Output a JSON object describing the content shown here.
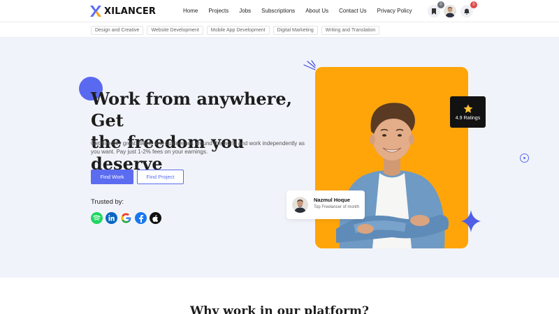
{
  "brand": {
    "name": "XILANCER"
  },
  "nav": [
    "Home",
    "Projects",
    "Jobs",
    "Subscriptions",
    "About Us",
    "Contact Us",
    "Privacy Policy"
  ],
  "header_icons": {
    "bookmark_count": "0",
    "notification_count": "0"
  },
  "categories": [
    "Design and Creative",
    "Website Development",
    "Mobile App Development",
    "Digital Marketing",
    "Writing and Translation"
  ],
  "hero": {
    "headline_line1": "Work from anywhere, Get",
    "headline_line2": "the freedom you deserve",
    "subtext": "Get hired by great clients and businesses around the world and work independently as you want. Pay just 1-2% fees on your earnings.",
    "find_work": "Find Work",
    "find_project": "Find Project",
    "trusted_by": "Trusted by:",
    "brands": [
      "spotify-icon",
      "linkedin-icon",
      "google-icon",
      "facebook-icon",
      "apple-icon"
    ],
    "rating": "4.9 Ratings",
    "freelancer_name": "Nazmul Hoque",
    "freelancer_role": "Top Freelancer of month"
  },
  "section": {
    "title": "Why work in our platform?"
  },
  "colors": {
    "accent": "#5b6cf0",
    "orange": "#ffa50a",
    "hero_bg": "#f1f3fa"
  }
}
